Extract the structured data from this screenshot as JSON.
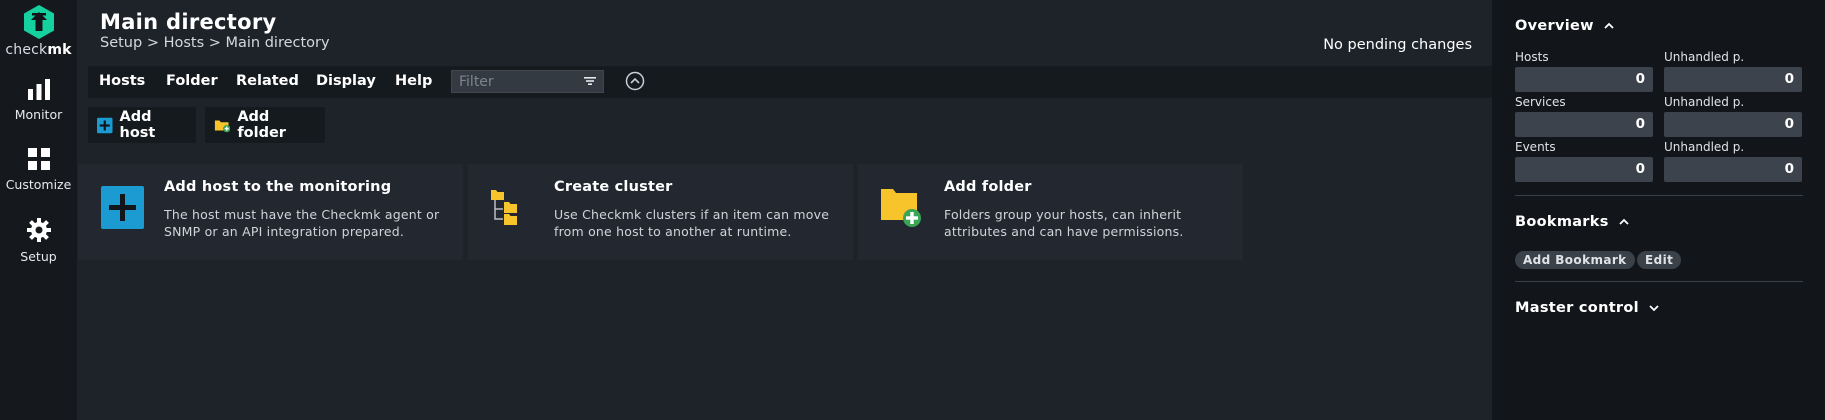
{
  "brand": {
    "name_light": "check",
    "name_bold": "mk",
    "accent": "#15d1a0"
  },
  "leftnav": [
    {
      "label": "Monitor",
      "icon": "bar-chart-icon"
    },
    {
      "label": "Customize",
      "icon": "grid-icon"
    },
    {
      "label": "Setup",
      "icon": "gear-icon"
    }
  ],
  "header": {
    "title": "Main directory",
    "breadcrumb": "Setup > Hosts > Main directory",
    "status": "No pending changes"
  },
  "menubar": {
    "items": [
      "Hosts",
      "Folder",
      "Related",
      "Display",
      "Help"
    ],
    "filter_placeholder": "Filter"
  },
  "actions": {
    "add_host": "Add host",
    "add_folder": "Add folder"
  },
  "cards": [
    {
      "title": "Add host to the monitoring",
      "desc": "The host must have the Checkmk agent or SNMP or an API integration prepared.",
      "icon": "add-host-icon"
    },
    {
      "title": "Create cluster",
      "desc": "Use Checkmk clusters if an item can move from one host to another at runtime.",
      "icon": "cluster-icon"
    },
    {
      "title": "Add folder",
      "desc": "Folders group your hosts, can inherit attributes and can have permissions.",
      "icon": "add-folder-icon"
    }
  ],
  "sidebar": {
    "overview": {
      "title": "Overview",
      "rows": [
        {
          "label": "Hosts",
          "value": "0",
          "unhandled_label": "Unhandled p.",
          "unhandled_value": "0"
        },
        {
          "label": "Services",
          "value": "0",
          "unhandled_label": "Unhandled p.",
          "unhandled_value": "0"
        },
        {
          "label": "Events",
          "value": "0",
          "unhandled_label": "Unhandled p.",
          "unhandled_value": "0"
        }
      ]
    },
    "bookmarks": {
      "title": "Bookmarks",
      "add_label": "Add Bookmark",
      "edit_label": "Edit"
    },
    "master_control": {
      "title": "Master control"
    }
  },
  "colors": {
    "folder_yellow": "#f7c52b",
    "host_blue": "#1b9bd1",
    "plus_green": "#3aa655"
  }
}
